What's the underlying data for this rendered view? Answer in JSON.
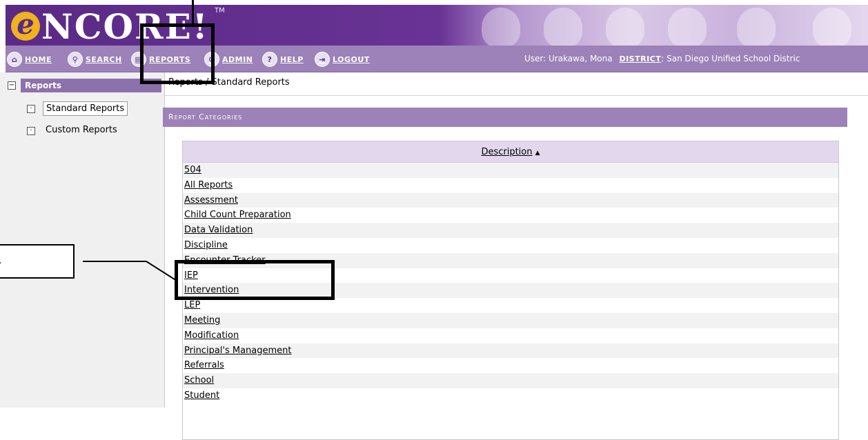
{
  "app": {
    "logo_text": "NCORE!",
    "logo_e": "e",
    "logo_tm": "TM"
  },
  "nav": {
    "items": [
      {
        "label": "Home",
        "icon": "home-icon"
      },
      {
        "label": "Search",
        "icon": "search-icon"
      },
      {
        "label": "Reports",
        "icon": "reports-icon"
      },
      {
        "label": "Admin",
        "icon": "admin-icon"
      },
      {
        "label": "Help",
        "icon": "help-icon"
      },
      {
        "label": "Logout",
        "icon": "logout-icon"
      }
    ],
    "user_label": "User: Urakawa, Mona",
    "district_label": "DISTRICT",
    "district_value": ": San Diego Unified School Distric"
  },
  "sidebar": {
    "root_label": "Reports",
    "root_toggle": "−",
    "children": [
      {
        "label": "Standard Reports",
        "toggle": "·"
      },
      {
        "label": "Custom Reports",
        "toggle": "·"
      }
    ]
  },
  "breadcrumb": "Reports / Standard Reports",
  "panel": {
    "title": "Report Categories",
    "column_header": "Description",
    "sort_indicator": "▲",
    "rows": [
      "504",
      "All Reports",
      "Assessment",
      "Child Count Preparation",
      "Data Validation",
      "Discipline",
      "Encounter Tracker",
      "IEP",
      "Intervention",
      "LEP",
      "Meeting",
      "Modification",
      "Principal's Management",
      "Referrals",
      "School",
      "Student"
    ]
  },
  "annotation": {
    "callout_text": "."
  },
  "colors": {
    "banner": "#5a2a86",
    "navbar": "#9c82b8",
    "panel_header": "#9c82b8",
    "table_header": "#e3d7ee"
  }
}
